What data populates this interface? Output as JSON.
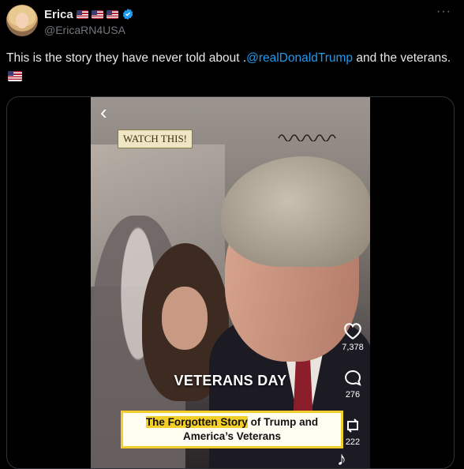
{
  "author": {
    "name": "Erica",
    "handle": "@EricaRN4USA"
  },
  "more_menu": "···",
  "tweet": {
    "text_before": "This is the story they have never told about .",
    "mention": "@realDonaldTrump",
    "text_after": " and the veterans."
  },
  "video": {
    "watch_label": "WATCH THIS!",
    "headline": "VETERANS DAY",
    "story_highlight": "The Forgotten Story",
    "story_rest": " of Trump and",
    "story_line2": "America’s Veterans",
    "like_count": "7,378",
    "comment_count": "276",
    "repost_count": "222"
  },
  "colors": {
    "background": "#000000",
    "accent": "#1d9bf0",
    "muted": "#71767b",
    "highlight": "#f4cf29"
  },
  "icons": [
    "verified-badge-icon",
    "us-flag-icon",
    "back-icon",
    "heart-icon",
    "comment-icon",
    "repost-icon",
    "tiktok-icon"
  ]
}
